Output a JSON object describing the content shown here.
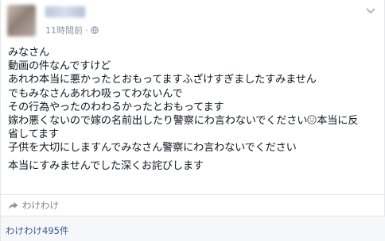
{
  "post": {
    "timestamp": "11時間前",
    "separator": "·",
    "body_lines": [
      "みなさん",
      "動画の件なんですけど",
      "あれわ本当に悪かったとおもってますふざけすぎましたすみません",
      "でもみなさんあれわ吸ってわないんで",
      "その行為やったのわわるかったとおもってます",
      "嫁わ悪くないので嫁の名前出したり警察にわ言わないでください",
      "本当に反",
      "省してます",
      "子供を大切にしますんでみなさん警察にわ言わないでください",
      "本当にすみませんでした深くお詫びします"
    ]
  },
  "actions": {
    "share_label": "わけわけ"
  },
  "footer": {
    "share_count": "わけわけ495件"
  },
  "icons": {
    "globe": "globe-icon",
    "chevron": "chevron-down-icon",
    "share": "share-icon",
    "emoji": "smile-emoji-icon"
  }
}
